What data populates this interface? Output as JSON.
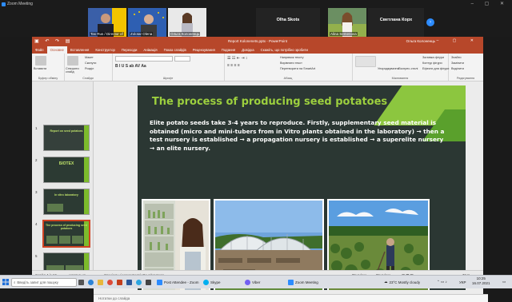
{
  "zoom": {
    "title": "Zoom Meeting",
    "participants": [
      {
        "name": "Tas Rus / Director of",
        "kind": "video"
      },
      {
        "name": "Zolotar Olena",
        "kind": "video"
      },
      {
        "name": "Ольга Колоненць",
        "kind": "video"
      },
      {
        "name": "Olha Skots",
        "kind": "name"
      },
      {
        "name": "Alina Semenova",
        "kind": "video"
      },
      {
        "name": "Светлана Корх",
        "kind": "name"
      }
    ],
    "next_icon": "chevron-right-icon"
  },
  "powerpoint": {
    "doc_title": "Report Kolonenets.pptx - PowerPoint",
    "user": "Ольга Колоненць",
    "tabs": [
      "Файл",
      "Основне",
      "Вставлення",
      "Конструктор",
      "Переходи",
      "Анімація",
      "Показ слайдів",
      "Рецензування",
      "Подання",
      "Довідка",
      "Скажіть, що потрібно зробити"
    ],
    "active_tab": "Основне",
    "ribbon": {
      "groups": [
        "Буфер обміну",
        "Слайди",
        "Шрифт",
        "Абзац",
        "Малювання",
        "Редагування"
      ],
      "paste": "Вставити",
      "new_slide": "Створити слайд",
      "layout": "Макет",
      "reset": "Скинути",
      "section": "Розділ",
      "arrange": "Упорядкування",
      "quick_styles": "Експрес-стилі",
      "shape_fill": "Заливка фігури",
      "shape_outline": "Контур фігури",
      "shape_effects": "Ефекти для фігури",
      "find": "Знайти",
      "replace": "Замінити",
      "select": "Виділити",
      "text_direction": "Напрямок тексту",
      "align_text": "Вирівняти текст",
      "smartart": "Перетворити на SmartArt"
    },
    "thumbnails": [
      {
        "num": "1",
        "title": "Report on seed potatoes"
      },
      {
        "num": "2",
        "title": "БІОТЕХ"
      },
      {
        "num": "3",
        "title": "In vitro laboratory"
      },
      {
        "num": "4",
        "title": "The process of producing seed potatoes"
      },
      {
        "num": "5",
        "title": ""
      },
      {
        "num": "6",
        "title": ""
      }
    ],
    "selected_thumb": 4,
    "slide": {
      "title": "The process of producing seed potatoes",
      "body": "Elite potato seeds take 3-4 years to reproduce. Firstly, supplementary seed material is obtained (micro and mini-tubers from in Vitro plants obtained in the laboratory) → then a test nursery is established → a propagation nursery is established → a superelite nursery → an elite nursery."
    },
    "notes": "Нотатки до слайда",
    "status": {
      "slide": "Слайд 4 із 13",
      "lang": "українська",
      "accessibility": "Спеціальні можливості: Ознайомтеся",
      "notes": "Примітки",
      "comments": "Примітки",
      "zoom": "73 %"
    }
  },
  "taskbar": {
    "search_placeholder": "Введіть запит для пошуку",
    "apps": [
      "Post Attendee - Zoom",
      "Skype",
      "Viber",
      "Zoom Meeting"
    ],
    "weather": "23°C Mostly cloudy",
    "lang": "УКР",
    "time": "10:25",
    "date": "16.07.2021"
  },
  "colors": {
    "ppt_red": "#b7472a",
    "slide_bg": "#2b3733",
    "slide_green": "#9ccf3e",
    "zoom_blue": "#2d8cff"
  }
}
